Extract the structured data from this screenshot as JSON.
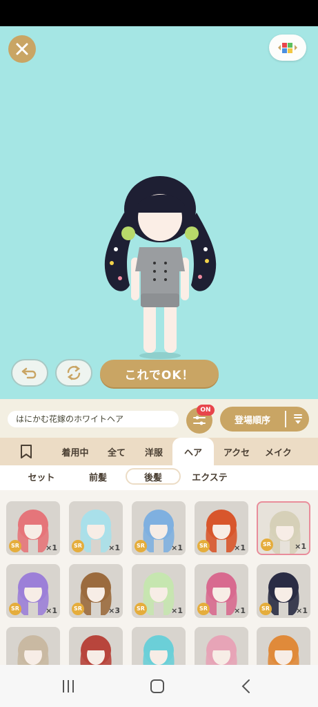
{
  "actions": {
    "ok_label": "これでOK！"
  },
  "item_name": "はにかむ花嫁のホワイトヘア",
  "filter": {
    "badge": "ON"
  },
  "sort": {
    "label": "登場順序"
  },
  "tabs": [
    "着用中",
    "全て",
    "洋服",
    "ヘア",
    "アクセ",
    "メイク"
  ],
  "active_tab": "ヘア",
  "subtabs": [
    "セット",
    "前髪",
    "後髪",
    "エクステ"
  ],
  "active_subtab": "後髪",
  "items": [
    {
      "rarity": "SR",
      "count": "×1",
      "hair": "#e5757a"
    },
    {
      "rarity": "SR",
      "count": "×1",
      "hair": "#a9e0ea"
    },
    {
      "rarity": "SR",
      "count": "×1",
      "hair": "#7fb0e0"
    },
    {
      "rarity": "SR",
      "count": "×1",
      "hair": "#d8562c"
    },
    {
      "rarity": "SR",
      "count": "×1",
      "hair": "#d6d0b8"
    },
    {
      "rarity": "SR",
      "count": "×1",
      "hair": "#9c7fd8"
    },
    {
      "rarity": "SR",
      "count": "×3",
      "hair": "#9b6b3e"
    },
    {
      "rarity": "SR",
      "count": "×1",
      "hair": "#c6e6b0"
    },
    {
      "rarity": "SR",
      "count": "×1",
      "hair": "#d86a8f"
    },
    {
      "rarity": "SR",
      "count": "×1",
      "hair": "#2a2c44"
    },
    {
      "rarity": "",
      "count": "",
      "hair": "#c9b9a2"
    },
    {
      "rarity": "",
      "count": "",
      "hair": "#b8453c"
    },
    {
      "rarity": "",
      "count": "",
      "hair": "#6bcfd8"
    },
    {
      "rarity": "",
      "count": "",
      "hair": "#e7a4b7"
    },
    {
      "rarity": "",
      "count": "",
      "hair": "#e08a3a"
    }
  ],
  "colors": {
    "accent": "#c9a564",
    "stage_bg": "#a5e6e4",
    "badge_red": "#e8454b"
  }
}
